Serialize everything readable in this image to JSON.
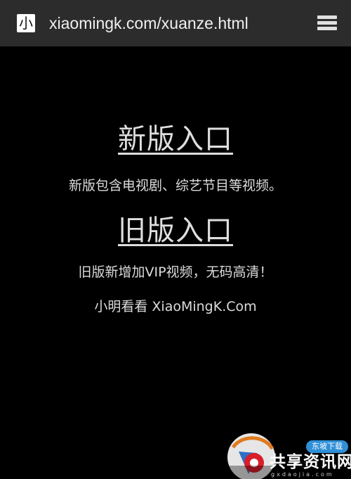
{
  "browser": {
    "site_icon": "小",
    "url": "xiaomingk.com/xuanze.html",
    "menu_icon": "hamburger-menu-icon"
  },
  "main": {
    "new_entry": {
      "label": "新版入口",
      "description": "新版包含电视剧、综艺节目等视频。"
    },
    "old_entry": {
      "label": "旧版入口",
      "description": "旧版新增加VIP视频，无码高清！"
    },
    "brand_text": "小明看看 XiaoMingK.Com"
  },
  "watermark": {
    "badge": "东坡下载",
    "text": "共享资讯网",
    "sub": "gxdaojia.com"
  },
  "colors": {
    "background": "#000000",
    "address_bar": "#2c2c2c",
    "link_text": "#dedede",
    "body_text": "#dcdcdc"
  }
}
